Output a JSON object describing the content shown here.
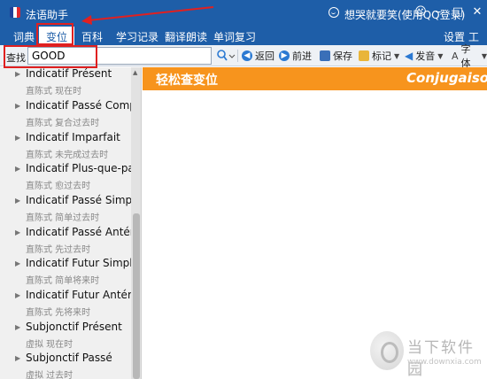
{
  "titlebar": {
    "app_title": "法语助手",
    "user_label": "想哭就要笑(使用QQ登录)",
    "min_glyph": "–",
    "max_glyph": "□",
    "close_glyph": "✕"
  },
  "menu": {
    "tabs": [
      "词典",
      "变位",
      "百科",
      "学习记录",
      "翻译朗读",
      "单词复习"
    ],
    "active_tab": "变位",
    "settings": "设置",
    "tools": "工具"
  },
  "toolbar": {
    "search_label": "查找",
    "search_value": "GOOD",
    "back": "返回",
    "forward": "前进",
    "save": "保存",
    "bookmark": "标记",
    "pronounce": "发音",
    "font": "字体"
  },
  "conjugation_list": [
    {
      "name": "Indicatif Présent",
      "sub": "直陈式 现在时"
    },
    {
      "name": "Indicatif Passé Composé",
      "sub": "直陈式 复合过去时"
    },
    {
      "name": "Indicatif Imparfait",
      "sub": "直陈式 未完成过去时"
    },
    {
      "name": "Indicatif Plus-que-parfait",
      "sub": "直陈式 愈过去时"
    },
    {
      "name": "Indicatif Passé Simple",
      "sub": "直陈式 简单过去时"
    },
    {
      "name": "Indicatif Passé Antérieur",
      "sub": "直陈式 先过去时"
    },
    {
      "name": "Indicatif Futur Simple",
      "sub": "直陈式 简单将来时"
    },
    {
      "name": "Indicatif Futur Antérieur",
      "sub": "直陈式 先将来时"
    },
    {
      "name": "Subjonctif Présent",
      "sub": "虚拟 现在时"
    },
    {
      "name": "Subjonctif Passé",
      "sub": "虚拟 过去时"
    }
  ],
  "banner": {
    "left": "轻松查变位",
    "right": "Conjugaison"
  },
  "watermark": {
    "title": "当下软件园",
    "url": "www.downxia.com"
  },
  "colors": {
    "titlebar": "#1e5ea8",
    "banner": "#f7941d",
    "highlight": "#e02020"
  }
}
